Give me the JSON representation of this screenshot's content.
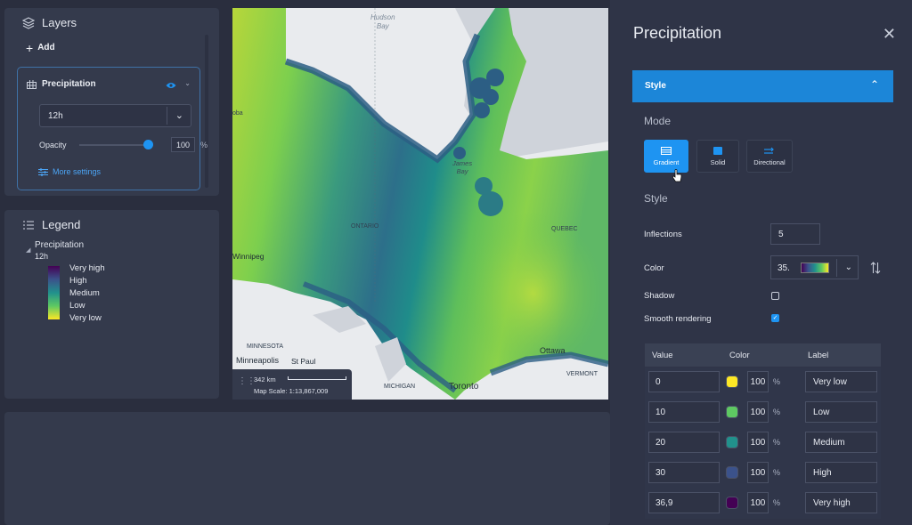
{
  "layers_panel": {
    "title": "Layers",
    "add_label": "Add",
    "layer": {
      "name": "Precipitation",
      "time_select": "12h",
      "opacity_label": "Opacity",
      "opacity_value": "100",
      "opacity_unit": "%",
      "opacity_level": 1.0,
      "more_settings": "More settings"
    }
  },
  "legend_panel": {
    "title": "Legend",
    "layer_name": "Precipitation",
    "layer_time": "12h",
    "items": [
      "Very high",
      "High",
      "Medium",
      "Low",
      "Very low"
    ]
  },
  "map": {
    "labels": {
      "hudson_bay": "Hudson\nBay",
      "ontario": "ONTARIO",
      "quebec": "QUEBEC",
      "james_bay": "James\nBay",
      "winnipeg": "Winnipeg",
      "minnesota": "MINNESOTA",
      "minneapolis": "Minneapolis",
      "st_paul": "St Paul",
      "michigan": "MICHIGAN",
      "toronto": "Toronto",
      "ottawa": "Ottawa",
      "vermont": "VERMONT",
      "oba": "oba"
    },
    "scale_distance": "342 km",
    "map_scale": "Map Scale: 1:13,867,009"
  },
  "style_panel": {
    "title": "Precipitation",
    "section_style": "Style",
    "mode_label": "Mode",
    "modes": [
      "Gradient",
      "Solid",
      "Directional"
    ],
    "active_mode": "Gradient",
    "style_label": "Style",
    "inflections_label": "Inflections",
    "inflections_value": "5",
    "color_label": "Color",
    "color_value_prefix": "35.",
    "shadow_label": "Shadow",
    "shadow_checked": false,
    "smooth_label": "Smooth rendering",
    "smooth_checked": true,
    "table": {
      "headers": [
        "Value",
        "Color",
        "Label"
      ],
      "rows": [
        {
          "value": "0",
          "color": "#fde725",
          "opacity": "100",
          "pct": "%",
          "label": "Very low"
        },
        {
          "value": "10",
          "color": "#5ec962",
          "opacity": "100",
          "pct": "%",
          "label": "Low"
        },
        {
          "value": "20",
          "color": "#21918c",
          "opacity": "100",
          "pct": "%",
          "label": "Medium"
        },
        {
          "value": "30",
          "color": "#3b528b",
          "opacity": "100",
          "pct": "%",
          "label": "High"
        },
        {
          "value": "36,9",
          "color": "#440154",
          "opacity": "100",
          "pct": "%",
          "label": "Very high"
        }
      ]
    }
  },
  "colors": {
    "accent": "#1e94f2",
    "panel": "#343a4c",
    "background": "#2a2e3e"
  }
}
